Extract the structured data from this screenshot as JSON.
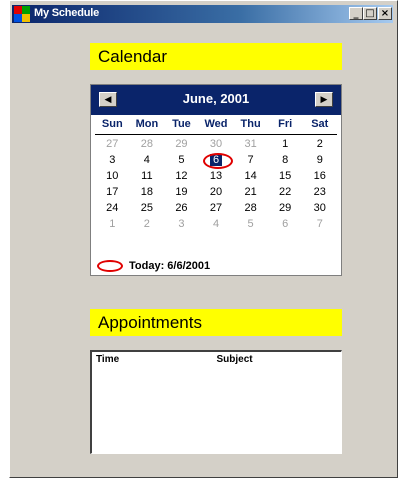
{
  "window": {
    "title": "My Schedule",
    "min_symbol": "_",
    "max_symbol": "□",
    "close_symbol": "×"
  },
  "calendar_section": {
    "label": "Calendar"
  },
  "calendar": {
    "month_label": "June, 2001",
    "prev_symbol": "◀",
    "next_symbol": "▶",
    "weekdays": [
      "Sun",
      "Mon",
      "Tue",
      "Wed",
      "Thu",
      "Fri",
      "Sat"
    ],
    "weeks": [
      [
        "27",
        "28",
        "29",
        "30",
        "31",
        "1",
        "2"
      ],
      [
        "3",
        "4",
        "5",
        "6",
        "7",
        "8",
        "9"
      ],
      [
        "10",
        "11",
        "12",
        "13",
        "14",
        "15",
        "16"
      ],
      [
        "17",
        "18",
        "19",
        "20",
        "21",
        "22",
        "23"
      ],
      [
        "24",
        "25",
        "26",
        "27",
        "28",
        "29",
        "30"
      ],
      [
        "1",
        "2",
        "3",
        "4",
        "5",
        "6",
        "7"
      ]
    ],
    "today_label": "Today: 6/6/2001",
    "accent_color": "#0a246a",
    "today_color": "#e00000"
  },
  "appointments_section": {
    "label": "Appointments"
  },
  "appointments_list": {
    "columns": [
      "Time",
      "Subject"
    ]
  }
}
